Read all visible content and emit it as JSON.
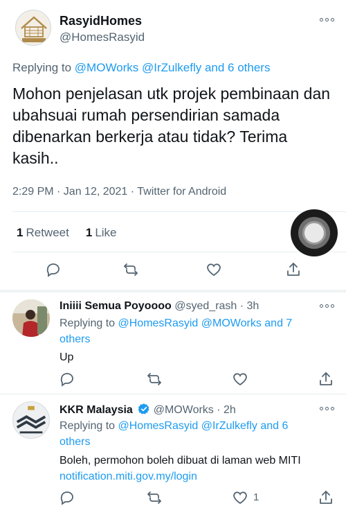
{
  "main_tweet": {
    "author_name": "RasyidHomes",
    "author_handle": "@HomesRasyid",
    "avatar_logo_text": "RASYID HOME",
    "replying_prefix": "Replying to",
    "replying_targets": "@MOWorks @IrZulkefly and 6 others",
    "text": "Mohon penjelasan utk projek pembinaan dan ubahsuai rumah persendirian samada dibenarkan berkerja atau tidak? Terima kasih..",
    "meta": "2:29 PM · Jan 12, 2021 · Twitter for Android",
    "retweet_count": "1",
    "retweet_label": "Retweet",
    "like_count": "1",
    "like_label": "Like"
  },
  "replies": [
    {
      "name": "Iniiii Semua Poyoooo",
      "handle_time": "@syed_rash · 3h",
      "replying_prefix": "Replying to",
      "replying_targets": "@HomesRasyid @MOWorks and 7 others",
      "text": "Up",
      "link": "",
      "like_count": ""
    },
    {
      "name": "KKR Malaysia",
      "handle_time": "@MOWorks · 2h",
      "replying_prefix": "Replying to",
      "replying_targets": "@HomesRasyid @IrZulkefly and 6 others",
      "text": "Boleh, permohon boleh dibuat di laman web MITI",
      "link": "notification.miti.gov.my/login",
      "like_count": "1"
    }
  ],
  "icons": {
    "reply": "comment-icon",
    "retweet": "retweet-icon",
    "like": "heart-icon",
    "share": "share-icon",
    "more": "more-options-icon",
    "verified": "verified-badge-icon",
    "overlay": "assistive-touch-icon"
  },
  "colors": {
    "accent": "#1d9bf0",
    "text_primary": "#0f1419",
    "text_secondary": "#536471"
  }
}
